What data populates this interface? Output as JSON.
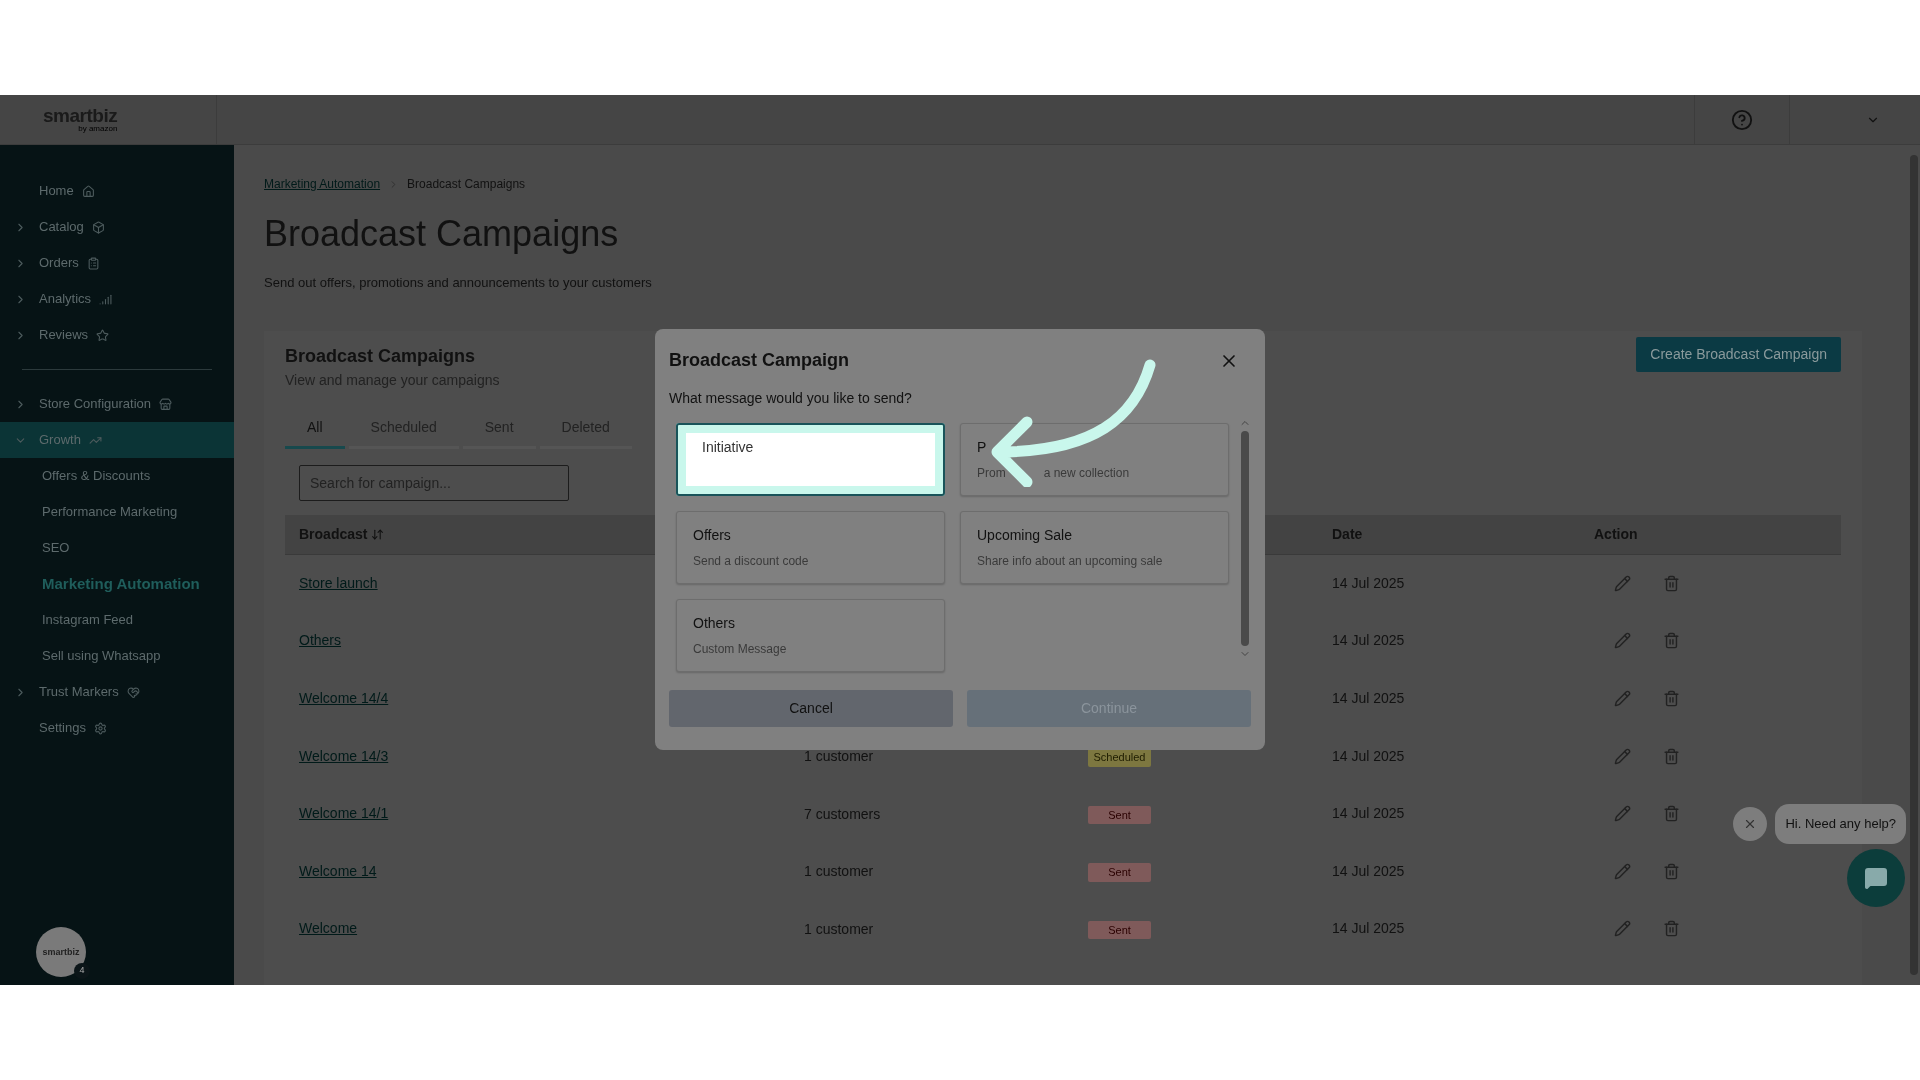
{
  "top_bar": {
    "logo": "smartbiz",
    "logo_sub": "by amazon"
  },
  "sidebar": {
    "sections": [
      [
        {
          "label": "Home",
          "expandable": false,
          "expanded": false,
          "selected": false
        },
        {
          "label": "Catalog",
          "expandable": true,
          "expanded": false,
          "selected": false
        },
        {
          "label": "Orders",
          "expandable": true,
          "expanded": false,
          "selected": false
        },
        {
          "label": "Analytics",
          "expandable": true,
          "expanded": false,
          "selected": false
        },
        {
          "label": "Reviews",
          "expandable": true,
          "expanded": false,
          "selected": false
        }
      ],
      [
        {
          "label": "Store Configuration",
          "expandable": true,
          "expanded": false,
          "selected": false
        },
        {
          "label": "Growth",
          "expandable": true,
          "expanded": true,
          "selected": false,
          "children": [
            {
              "label": "Offers & Discounts",
              "selected": false
            },
            {
              "label": "Performance Marketing",
              "selected": false
            },
            {
              "label": "SEO",
              "selected": false
            },
            {
              "label": "Marketing Automation",
              "selected": true
            },
            {
              "label": "Instagram Feed",
              "selected": false
            },
            {
              "label": "Sell using Whatsapp",
              "selected": false
            }
          ]
        },
        {
          "label": "Trust Markers",
          "expandable": true,
          "expanded": false,
          "selected": false
        },
        {
          "label": "Settings",
          "expandable": false,
          "expanded": false,
          "selected": false
        }
      ]
    ],
    "avatar": {
      "logo": "smartbiz",
      "badge": "4"
    }
  },
  "breadcrumb": [
    {
      "label": "Marketing Automation",
      "kind": "link"
    },
    {
      "label": "Broadcast Campaigns",
      "kind": "current"
    }
  ],
  "page_title": "Broadcast Campaigns",
  "page_description": "Send out offers, promotions and announcements to your customers",
  "card": {
    "title": "Broadcast Campaigns",
    "subtitle": "View and manage your campaigns",
    "create_button": "Create Broadcast Campaign",
    "tabs": [
      {
        "label": "All",
        "selected": true
      },
      {
        "label": "Scheduled",
        "selected": false
      },
      {
        "label": "Sent",
        "selected": false
      },
      {
        "label": "Deleted",
        "selected": false
      }
    ],
    "search": {
      "placeholder": "Search for campaign..."
    },
    "table": {
      "columns": [
        {
          "label": "Broadcast",
          "sortable": true
        },
        {
          "label": "Date",
          "sortable": false
        },
        {
          "label": "Action",
          "sortable": false
        }
      ],
      "rows": [
        {
          "name": "Store launch",
          "date": "14 Jul 2025"
        },
        {
          "name": "Others",
          "date": "14 Jul 2025"
        },
        {
          "name": "Welcome 14/4",
          "date": "14 Jul 2025"
        },
        {
          "name": "Welcome 14/3",
          "audience": "1 customer",
          "status": {
            "label": "Scheduled",
            "kind": "scheduled"
          },
          "date": "14 Jul 2025"
        },
        {
          "name": "Welcome 14/1",
          "audience": "7 customers",
          "status": {
            "label": "Sent",
            "kind": "sent"
          },
          "date": "14 Jul 2025"
        },
        {
          "name": "Welcome 14",
          "audience": "1 customer",
          "status": {
            "label": "Sent",
            "kind": "sent"
          },
          "date": "14 Jul 2025"
        },
        {
          "name": "Welcome",
          "audience": "1 customer",
          "status": {
            "label": "Sent",
            "kind": "sent"
          },
          "date": "14 Jul 2025"
        }
      ]
    }
  },
  "modal": {
    "title": "Broadcast Campaign",
    "question": "What message would you like to send?",
    "options": [
      {
        "title": "Initiative",
        "selected": true
      },
      {
        "title": "P",
        "subtitle_parts": [
          "Prom",
          "a new collection"
        ],
        "selected": false
      },
      {
        "title": "Offers",
        "subtitle_parts": [
          "Send a discount code"
        ],
        "selected": false
      },
      {
        "title": "Upcoming Sale",
        "subtitle_parts": [
          "Share info about an upcoming sale"
        ],
        "selected": false
      },
      {
        "title": "Others",
        "subtitle_parts": [
          "Custom Message"
        ],
        "selected": false
      }
    ],
    "cancel": {
      "label": "Cancel",
      "disabled": false
    },
    "continue": {
      "label": "Continue",
      "disabled": true
    }
  },
  "chat": {
    "greeting": "Hi. Need any help?"
  }
}
